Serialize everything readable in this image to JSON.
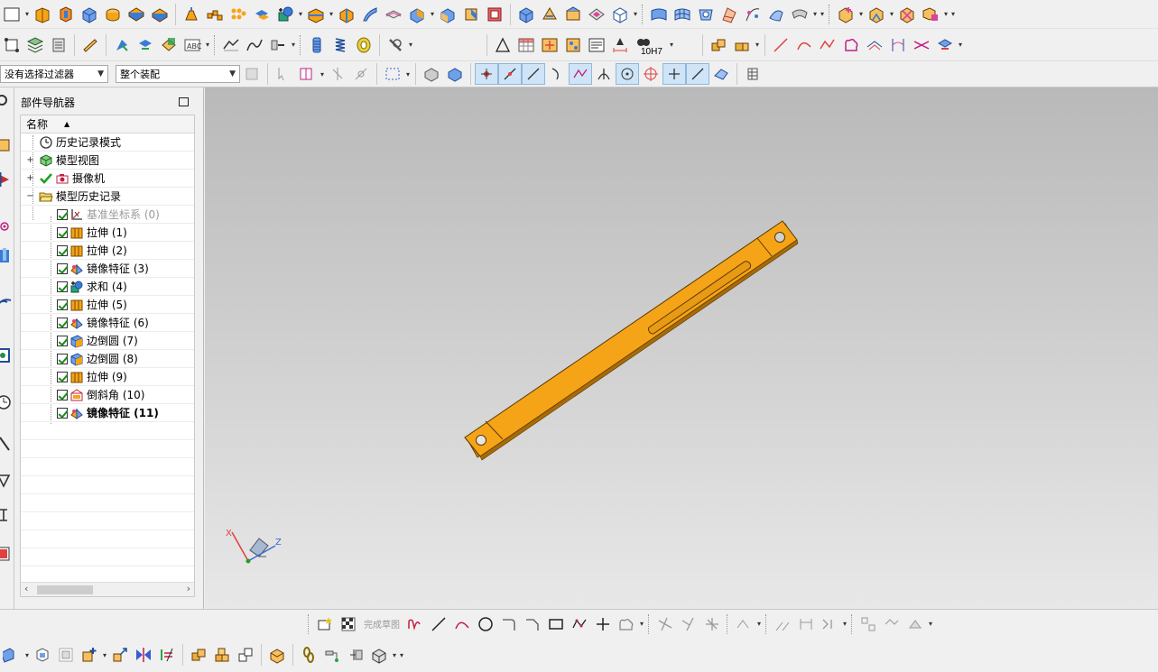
{
  "filters": {
    "selection_filter": "没有选择过滤器",
    "assembly_scope": "整个装配"
  },
  "navigator": {
    "title": "部件导航器",
    "column_name": "名称",
    "nodes": [
      {
        "label": "历史记录模式",
        "icon": "clock-icon"
      },
      {
        "label": "模型视图",
        "icon": "model-views-icon"
      },
      {
        "label": "摄像机",
        "icon": "camera-icon"
      },
      {
        "label": "模型历史记录",
        "icon": "folder-open-icon"
      }
    ],
    "features": [
      {
        "label": "基准坐标系 (0)",
        "icon": "datum-csys-icon",
        "dim": true
      },
      {
        "label": "拉伸 (1)",
        "icon": "extrude-icon"
      },
      {
        "label": "拉伸 (2)",
        "icon": "extrude-icon"
      },
      {
        "label": "镜像特征 (3)",
        "icon": "mirror-feature-icon"
      },
      {
        "label": "求和 (4)",
        "icon": "unite-icon"
      },
      {
        "label": "拉伸 (5)",
        "icon": "extrude-icon"
      },
      {
        "label": "镜像特征 (6)",
        "icon": "mirror-feature-icon"
      },
      {
        "label": "边倒圆 (7)",
        "icon": "edge-blend-icon"
      },
      {
        "label": "边倒圆 (8)",
        "icon": "edge-blend-icon"
      },
      {
        "label": "拉伸 (9)",
        "icon": "extrude-icon"
      },
      {
        "label": "倒斜角 (10)",
        "icon": "chamfer-icon"
      },
      {
        "label": "镜像特征 (11)",
        "icon": "mirror-feature-icon",
        "current": true
      }
    ]
  },
  "toolbar": {
    "tolerance_label": "10H7",
    "finish_sketch": "完成草图"
  },
  "triad": {
    "x_label": "X",
    "z_label": "Z"
  },
  "colors": {
    "part": "#f5a418",
    "part_edge": "#5a3a00",
    "viewport_top": "#b9b9b9",
    "viewport_bottom": "#e8e8e8"
  }
}
